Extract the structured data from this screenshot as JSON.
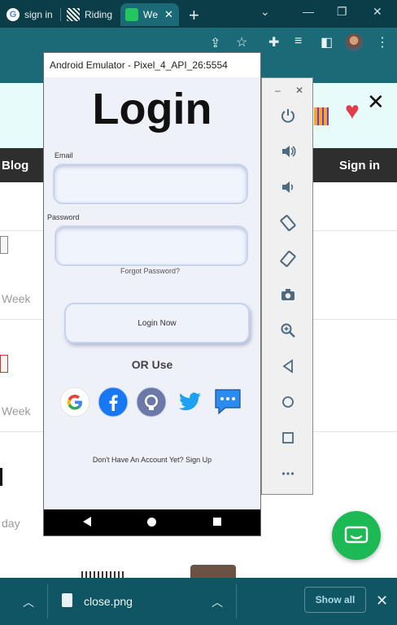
{
  "browser": {
    "tabs": [
      {
        "label": "sign in"
      },
      {
        "label": "Riding"
      },
      {
        "label": "Wе"
      }
    ],
    "new_tab_glyph": "+"
  },
  "webpage": {
    "nav_left": "Blog",
    "nav_right": "Sign in",
    "week_labels": [
      "Week",
      "Week"
    ],
    "day_label": "day"
  },
  "emulator": {
    "window_title": "Android Emulator - Pixel_4_API_26:5554",
    "app": {
      "title": "Login",
      "email_label": "Email",
      "password_label": "Password",
      "forgot_password": "Forgot Password?",
      "login_button": "Login Now",
      "or_use": "OR Use",
      "signup_text": "Don't Have An Account Yet? Sign Up",
      "social_providers": [
        "google-icon",
        "facebook-icon",
        "github-icon",
        "twitter-icon",
        "chat-icon"
      ]
    },
    "side_panel_controls": [
      "power-icon",
      "volume-up-icon",
      "volume-down-icon",
      "rotate-left-icon",
      "rotate-right-icon",
      "camera-icon",
      "zoom-icon",
      "back-icon",
      "home-icon",
      "overview-icon",
      "more-icon"
    ]
  },
  "downloads": {
    "file_name": "close.png",
    "show_all": "Show all"
  },
  "colors": {
    "chrome_frame": "#0b3d48",
    "chrome_toolbar": "#1a6a78",
    "download_bar": "#0f5563",
    "chat_fab": "#1db954"
  }
}
